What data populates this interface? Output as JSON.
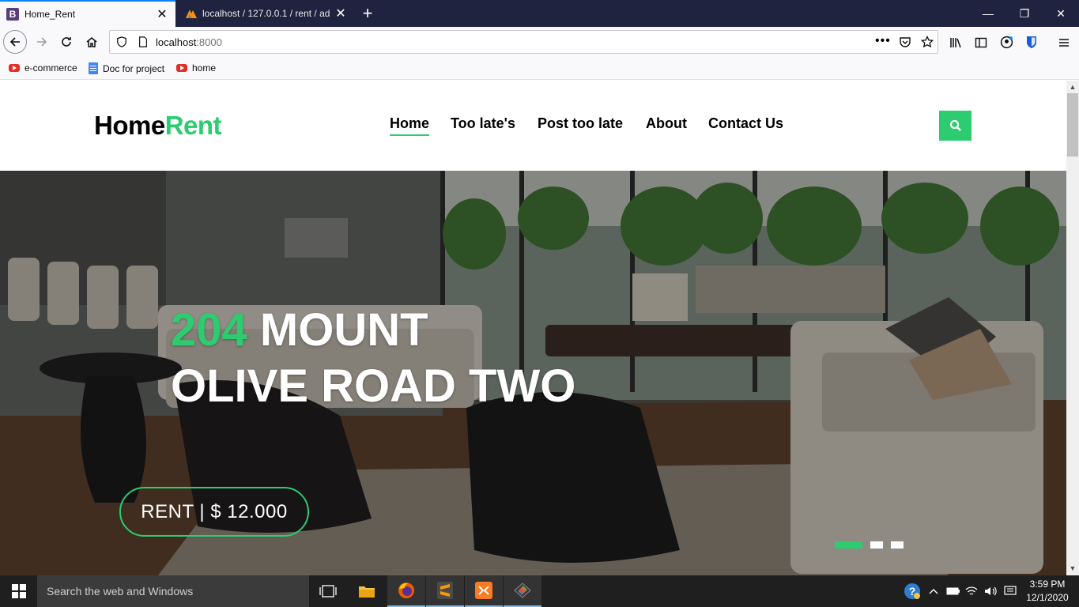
{
  "browser": {
    "tabs": [
      {
        "title": "Home_Rent",
        "favicon": "bootstrap-icon",
        "active": true
      },
      {
        "title": "localhost / 127.0.0.1 / rent / ad",
        "favicon": "phpmyadmin-icon",
        "active": false
      }
    ],
    "url_host": "localhost",
    "url_port": ":8000",
    "bookmarks": [
      {
        "label": "e-commerce",
        "icon": "youtube-icon"
      },
      {
        "label": "Doc for project",
        "icon": "docs-icon"
      },
      {
        "label": "home",
        "icon": "youtube-icon"
      }
    ]
  },
  "site": {
    "logo_part1": "Home",
    "logo_part2": "Rent",
    "menu": [
      "Home",
      "Too late's",
      "Post too late",
      "About",
      "Contact Us"
    ],
    "active_menu": "Home",
    "accent_color": "#2dcc70"
  },
  "hero": {
    "title_number": "204",
    "title_rest_line1": " MOUNT",
    "title_line2": "OLIVE ROAD TWO",
    "rent_label": "RENT | $ 12.000",
    "slide_count": 3,
    "active_slide": 1
  },
  "taskbar": {
    "search_placeholder": "Search the web and Windows",
    "apps": [
      "task-view-icon",
      "file-explorer-icon",
      "firefox-icon",
      "sublime-text-icon",
      "xampp-icon",
      "git-icon"
    ],
    "time": "3:59 PM",
    "date": "12/1/2020"
  }
}
